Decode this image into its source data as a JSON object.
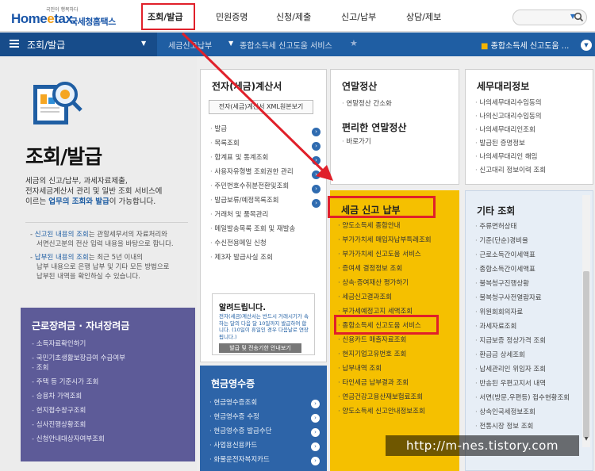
{
  "header": {
    "logo_small": "국민이 행복하다",
    "logo_main": "Home",
    "logo_e": "e",
    "logo_tax": "tax.",
    "logo_kr": "국세청홈택스",
    "nav": [
      "조회/발급",
      "민원증명",
      "신청/제출",
      "신고/납부",
      "상담/제보"
    ],
    "search_placeholder": ""
  },
  "breadcrumb": {
    "section": "조회/발급",
    "item1": "세금신고납부",
    "item2": "종합소득세 신고도움 서비스",
    "right_prefix": "■",
    "right": "종합소득세 신고도움 ..."
  },
  "left": {
    "title": "조회/발급",
    "desc_line1": "세금의 신고/납부, 과세자료제출,",
    "desc_line2": "전자세금계산서 관리 및 일반 조회 서비스에",
    "desc_line3_pre": "이르는 ",
    "desc_line3_hl": "업무의 조회와 발급",
    "desc_line3_post": "이 가능합니다.",
    "note1_pre": "- ",
    "note1_hl": "신고된 내용의 조회",
    "note1_post": "는 관할세무서의 자료처리와",
    "note1_line2": "서면신고분의 전산 입력 내용을 바탕으로 합니다.",
    "note2_pre": "- ",
    "note2_hl": "납부된 내용의 조회",
    "note2_post": "는 최근 5년 이내의",
    "note2_line2": "납부 내용으로 은행 납부 및 기타 모든 방법으로",
    "note2_line3": "납부된 내역을 확인하실 수 있습니다.",
    "purple_title": "근로장려금 · 자녀장려금",
    "purple_items": [
      "소득자료확인하기",
      "국민기초생활보장급여 수급여부",
      "조회",
      "주택 등 기준시가 조회",
      "승용차 가액조회",
      "현지접수창구조회",
      "심사진행상황조회",
      "신청안내대상자여부조회"
    ]
  },
  "col1": {
    "title": "전자(세금)계산서",
    "button": "전자(세금)계산서 XML원본보기",
    "items": [
      "발급",
      "목록조회",
      "합계표 및 통계조회",
      "사용자유형별 조회권한 관리",
      "주민번호수취분전환및조회",
      "발급보류/예정목록조회",
      "거래처 및 품목관리",
      "메일발송목록 조회 및 재발송",
      "수신전용메일 신청",
      "제3자 발급사실 조회"
    ],
    "notice_title": "알려드립니다.",
    "notice_body": "전자(세금)계산서는 반드시 거래시기가 속하는 달의 다음 달 10일까지 발급하여 합니다. (10일이 휴일인 경우 다음날로 연장됩니다.)",
    "notice_button": "발급 및 전송기한 안내보기"
  },
  "col2": {
    "title": "현금영수증",
    "items": [
      "현금영수증조회",
      "현금영수증 수정",
      "현금영수증 발급수단",
      "사업용신용카드",
      "화물운전자복지카드"
    ]
  },
  "col3": {
    "title": "연말정산",
    "items": [
      "연말정산 간소화"
    ],
    "title2": "편리한 연말정산",
    "items2": [
      "바로가기"
    ]
  },
  "col4": {
    "title": "세금 신고 납부",
    "items": [
      "양도소득세 종합안내",
      "부가가치세 매입자납부특례조회",
      "부가가치세 신고도움 서비스",
      "증여세 결정정보 조회",
      "상속·증여재산 평가하기",
      "세금신고결과조회",
      "부가세예정고지 세액조회",
      "종합소득세 신고도움 서비스",
      "신용카드 매출자료조회",
      "현지기업고유번호 조회",
      "납부내역 조회",
      "타인세금 납부결과 조회",
      "연금건강고용산재보험료조회",
      "양도소득세 신고안내정보조회"
    ]
  },
  "col5": {
    "title": "세무대리정보",
    "items": [
      "나의세무대리수임동의",
      "나의신고대리수임동의",
      "나의세무대리인조회",
      "발급된 증명정보",
      "나의세무대리인 해임",
      "신고대리 정보이력 조회"
    ]
  },
  "col6": {
    "title": "기타 조회",
    "items": [
      "주류면허상태",
      "기준(단순)경비율",
      "근로소득간이세액표",
      "종합소득간이세액표",
      "불복청구진행상황",
      "불복청구사전열람자료",
      "위원회회의자료",
      "과세자료조회",
      "지급보증 정상가격 조회",
      "환급금 상세조회",
      "납세관리인 위임자 조회",
      "반송된 우편고지서 내역",
      "서면(방문,우편등) 접수현황조회",
      "상속인국세정보조회",
      "전통시장 정보 조회"
    ]
  },
  "watermark": "http://m-nes.tistory.com",
  "colors": {
    "nav_blue": "#1f5ea3",
    "highlight_red": "#e0202a",
    "tax_yellow": "#f5c000",
    "purple": "#5d5b98"
  }
}
